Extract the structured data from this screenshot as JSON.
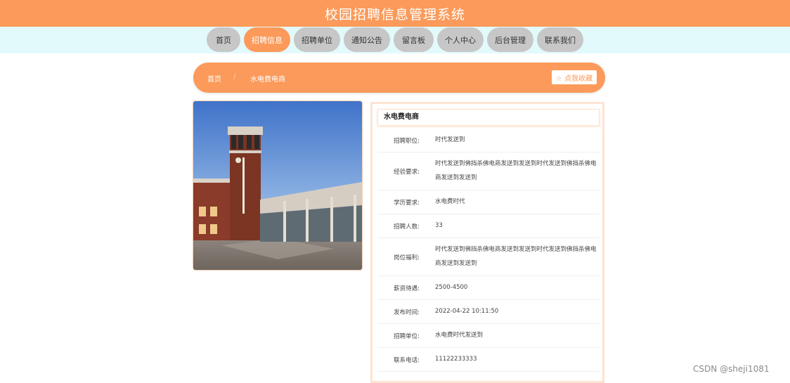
{
  "header": {
    "title": "校园招聘信息管理系统"
  },
  "nav": {
    "items": [
      {
        "label": "首页"
      },
      {
        "label": "招聘信息"
      },
      {
        "label": "招聘单位"
      },
      {
        "label": "通知公告"
      },
      {
        "label": "留言板"
      },
      {
        "label": "个人中心"
      },
      {
        "label": "后台管理"
      },
      {
        "label": "联系我们"
      }
    ],
    "active": "招聘信息"
  },
  "breadcrumb": {
    "home": "首页",
    "separator": "/",
    "current": "水电费电商"
  },
  "favorite_button": {
    "label": "☆ 点我收藏"
  },
  "detail": {
    "title": "水电费电商",
    "fields": [
      {
        "label": "招聘职位:",
        "value": "时代发送到"
      },
      {
        "label": "经验要求:",
        "value": "时代发送到佛挡杀佛电商发送到发送到时代发送到佛挡杀佛电商发送到发送到"
      },
      {
        "label": "学历要求:",
        "value": "水电费时代"
      },
      {
        "label": "招聘人数:",
        "value": "33"
      },
      {
        "label": "岗位福利:",
        "value": "时代发送到佛挡杀佛电商发送到发送到时代发送到佛挡杀佛电商发送到发送到"
      },
      {
        "label": "薪资待遇:",
        "value": "2500-4500"
      },
      {
        "label": "发布时间:",
        "value": "2022-04-22 10:11:50"
      },
      {
        "label": "招聘单位:",
        "value": "水电费时代发送到"
      },
      {
        "label": "联系电话:",
        "value": "11122233333"
      }
    ]
  },
  "watermark": "CSDN @sheji1081"
}
